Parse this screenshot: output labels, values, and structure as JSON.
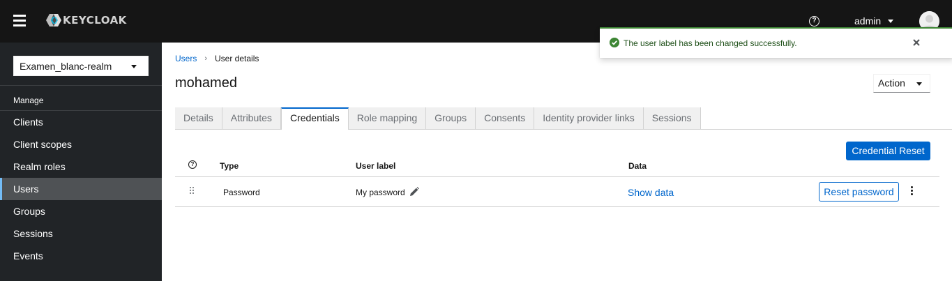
{
  "header": {
    "logo_text": "KEYCLOAK",
    "user_name": "admin"
  },
  "sidebar": {
    "realm": "Examen_blanc-realm",
    "section_title": "Manage",
    "items": [
      {
        "label": "Clients"
      },
      {
        "label": "Client scopes"
      },
      {
        "label": "Realm roles"
      },
      {
        "label": "Users",
        "active": true
      },
      {
        "label": "Groups"
      },
      {
        "label": "Sessions"
      },
      {
        "label": "Events"
      }
    ]
  },
  "breadcrumb": {
    "parent": "Users",
    "current": "User details"
  },
  "page": {
    "title": "mohamed",
    "action_label": "Action"
  },
  "tabs": [
    {
      "label": "Details"
    },
    {
      "label": "Attributes"
    },
    {
      "label": "Credentials",
      "active": true
    },
    {
      "label": "Role mapping"
    },
    {
      "label": "Groups"
    },
    {
      "label": "Consents"
    },
    {
      "label": "Identity provider links"
    },
    {
      "label": "Sessions"
    }
  ],
  "credentials": {
    "reset_button": "Credential Reset",
    "columns": {
      "type": "Type",
      "user_label": "User label",
      "data": "Data"
    },
    "rows": [
      {
        "type": "Password",
        "user_label": "My password",
        "data_link": "Show data",
        "action": "Reset password"
      }
    ]
  },
  "alert": {
    "message": "The user label has been changed successfully.",
    "variant": "success"
  },
  "colors": {
    "accent": "#0066cc",
    "masthead": "#151515",
    "sidebar": "#212427",
    "success": "#3e8635"
  }
}
